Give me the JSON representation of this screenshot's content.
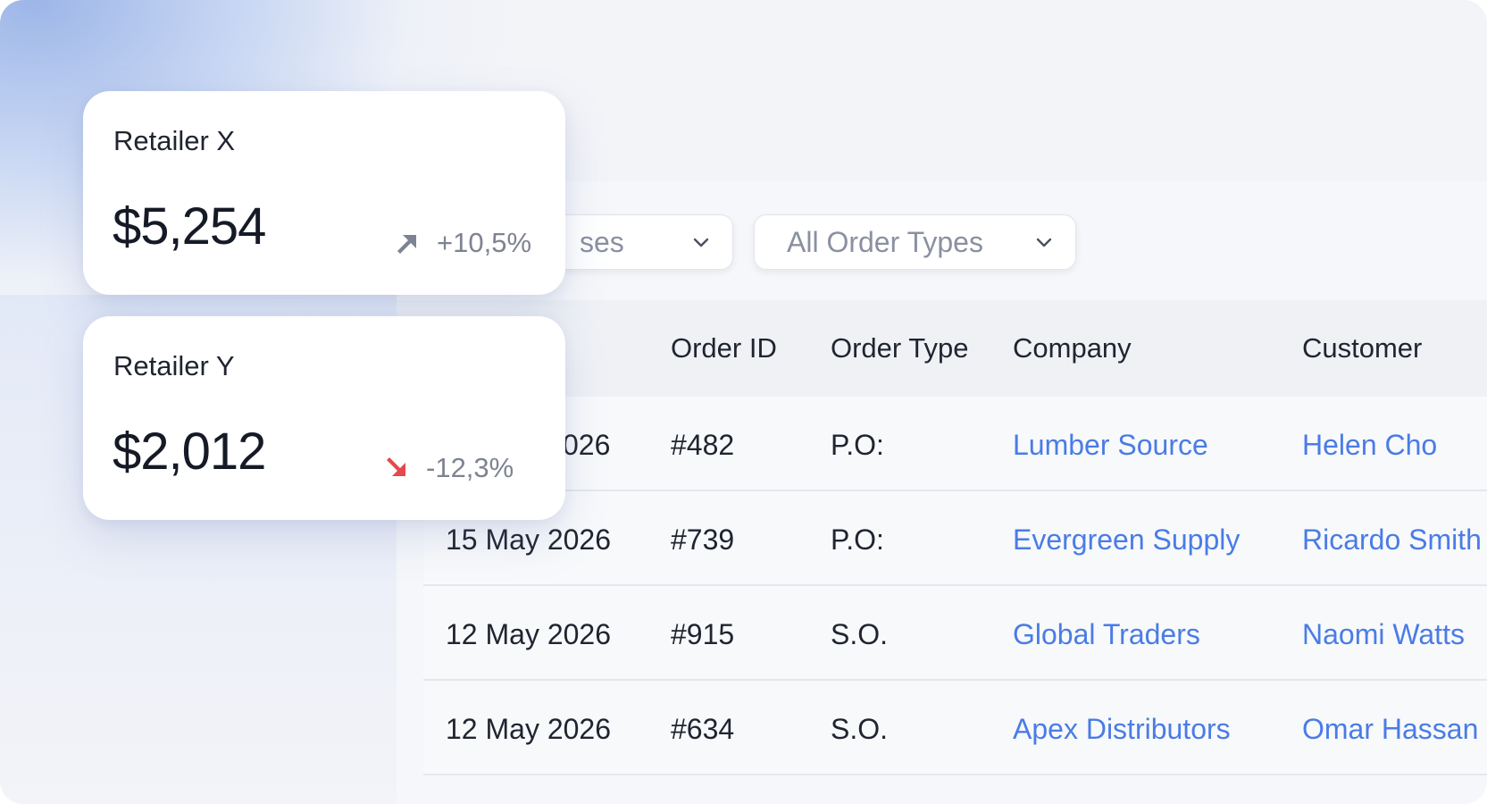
{
  "cards": [
    {
      "name": "Retailer X",
      "value": "$5,254",
      "change": "+10,5%",
      "direction": "up",
      "color": "#7d8391"
    },
    {
      "name": "Retailer Y",
      "value": "$2,012",
      "change": "-12,3%",
      "direction": "down",
      "color": "#e5484d"
    }
  ],
  "filters": {
    "status_label": "All Statuses",
    "status_visible": "ses",
    "type_label": "All Order Types"
  },
  "table": {
    "headers": [
      "Order ID",
      "Order Type",
      "Company",
      "Customer"
    ],
    "rows": [
      {
        "date": "026",
        "order_id": "#482",
        "order_type": "P.O:",
        "company": "Lumber Source",
        "customer": "Helen Cho"
      },
      {
        "date": "15 May 2026",
        "order_id": "#739",
        "order_type": "P.O:",
        "company": "Evergreen Supply",
        "customer": "Ricardo Smith"
      },
      {
        "date": "12 May 2026",
        "order_id": "#915",
        "order_type": "S.O.",
        "company": "Global Traders",
        "customer": "Naomi Watts"
      },
      {
        "date": "12 May 2026",
        "order_id": "#634",
        "order_type": "S.O.",
        "company": "Apex Distributors",
        "customer": "Omar Hassan"
      }
    ]
  },
  "colors": {
    "link": "#4a7ce6",
    "trend_up_icon": "#7d8391",
    "trend_down_icon": "#e5484d"
  }
}
